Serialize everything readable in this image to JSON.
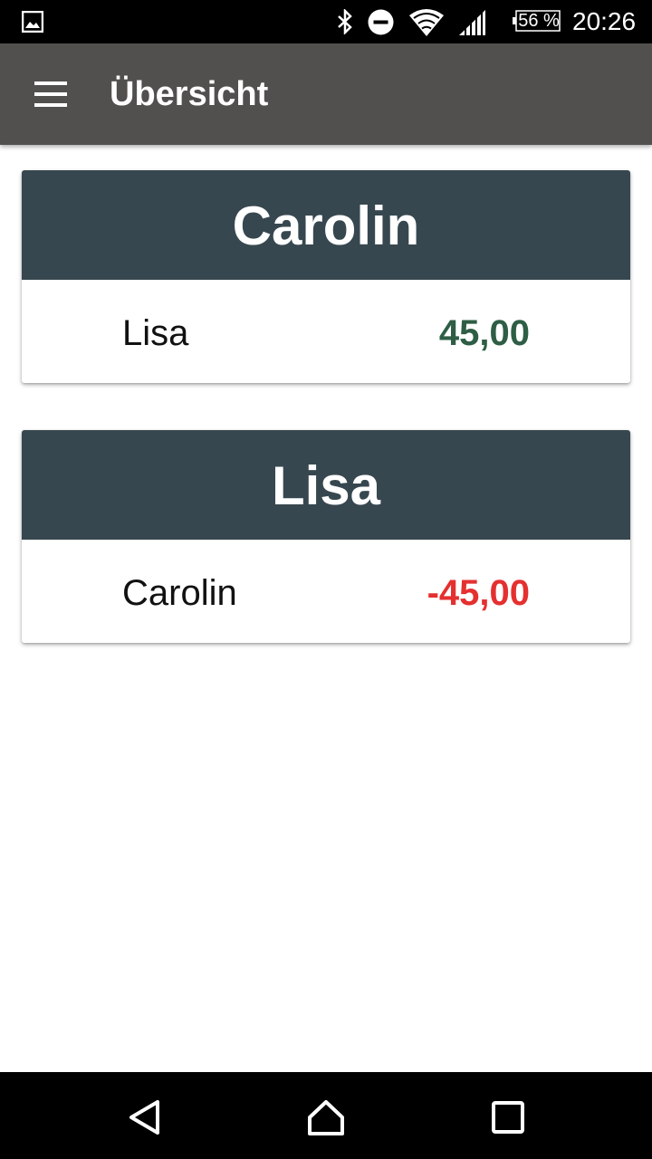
{
  "status_bar": {
    "battery_percent": "56 %",
    "time": "20:26",
    "icons": [
      "gallery-icon",
      "bluetooth-icon",
      "do-not-disturb-icon",
      "wifi-icon",
      "signal-icon",
      "battery-icon"
    ]
  },
  "app_bar": {
    "title": "Übersicht",
    "menu_icon": "menu-icon"
  },
  "colors": {
    "app_bar": "#51504e",
    "card_header": "#37474f",
    "positive": "#2e5e45",
    "negative": "#e53030"
  },
  "cards": [
    {
      "person": "Carolin",
      "rows": [
        {
          "name": "Lisa",
          "amount": "45,00",
          "sign": "positive"
        }
      ]
    },
    {
      "person": "Lisa",
      "rows": [
        {
          "name": "Carolin",
          "amount": "-45,00",
          "sign": "negative"
        }
      ]
    }
  ],
  "nav_bar": {
    "buttons": [
      "back-icon",
      "home-icon",
      "recents-icon"
    ]
  }
}
